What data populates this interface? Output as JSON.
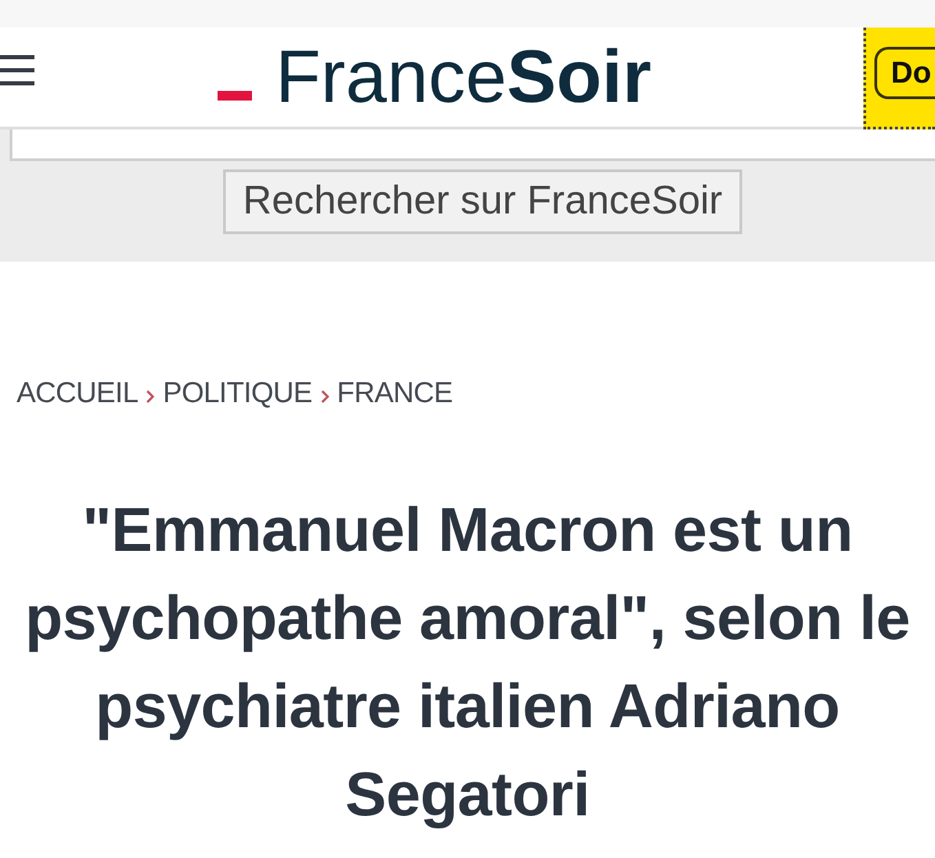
{
  "header": {
    "logo": "France**Soir**",
    "button": "Do"
  },
  "search": {
    "button": "Rechercher sur FranceSoir"
  },
  "breadcrumb": [
    "ACCUEIL",
    "POLITIQUE",
    "FRANCE"
  ],
  "article": {
    "title": "\"Emmanuel Macron est un psychopathe amoral\", selon le psychiatre italien Adriano Segatori"
  }
}
